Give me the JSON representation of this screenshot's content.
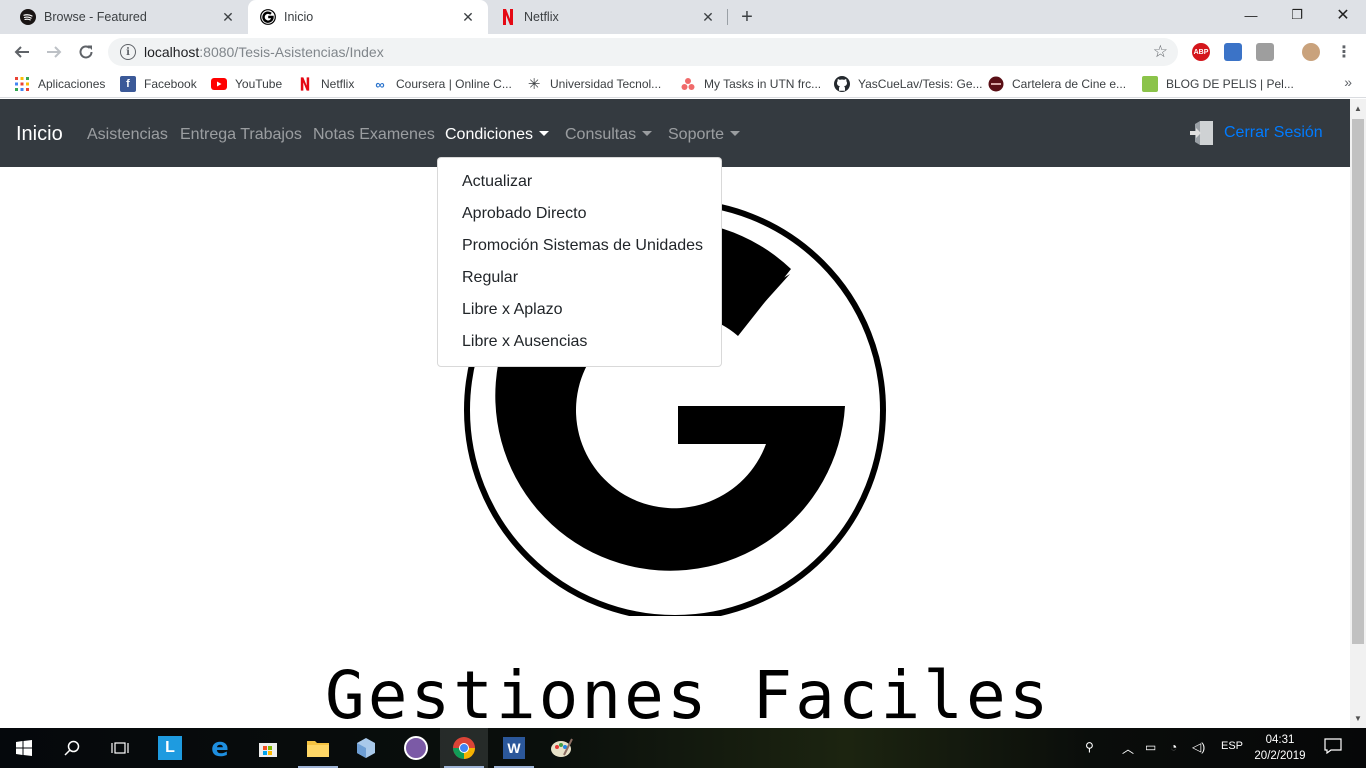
{
  "browser": {
    "tabs": [
      {
        "title": "Browse - Featured",
        "icon": "spotify-icon",
        "active": false
      },
      {
        "title": "Inicio",
        "icon": "g-logo-icon",
        "active": true
      },
      {
        "title": "Netflix",
        "icon": "netflix-icon",
        "active": false
      }
    ],
    "url_host": "localhost",
    "url_path": ":8080/Tesis-Asistencias/Index",
    "bookmarks": [
      {
        "label": "Aplicaciones",
        "icon": "apps-grid-icon"
      },
      {
        "label": "Facebook",
        "icon": "facebook-icon"
      },
      {
        "label": "YouTube",
        "icon": "youtube-icon"
      },
      {
        "label": "Netflix",
        "icon": "netflix-icon"
      },
      {
        "label": "Coursera | Online C...",
        "icon": "coursera-icon"
      },
      {
        "label": "Universidad Tecnol...",
        "icon": "utn-icon"
      },
      {
        "label": "My Tasks in UTN frc...",
        "icon": "asana-icon"
      },
      {
        "label": "YasCueLav/Tesis: Ge...",
        "icon": "github-icon"
      },
      {
        "label": "Cartelera de Cine e...",
        "icon": "cinema-icon"
      },
      {
        "label": "BLOG DE PELIS | Pel...",
        "icon": "blog-icon"
      }
    ],
    "extensions": [
      "ABP"
    ]
  },
  "page": {
    "navbar": {
      "brand": "Inicio",
      "links": [
        {
          "label": "Asistencias",
          "dropdown": false
        },
        {
          "label": "Entrega Trabajos",
          "dropdown": false
        },
        {
          "label": "Notas Examenes",
          "dropdown": false
        },
        {
          "label": "Condiciones",
          "dropdown": true,
          "active": true
        },
        {
          "label": "Consultas",
          "dropdown": true
        },
        {
          "label": "Soporte",
          "dropdown": true
        }
      ],
      "logout_label": "Cerrar Sesión"
    },
    "dropdown_items": [
      "Actualizar",
      "Aprobado Directo",
      "Promoción Sistemas de Unidades",
      "Regular",
      "Libre x Aplazo",
      "Libre x Ausencias"
    ],
    "logo_text": "Gestiones Faciles"
  },
  "taskbar": {
    "language": "ESP",
    "time": "04:31",
    "date": "20/2/2019"
  },
  "colors": {
    "navbar_bg": "#343a40",
    "link_primary": "#007bff",
    "tabstrip_bg": "#dee1e6"
  }
}
